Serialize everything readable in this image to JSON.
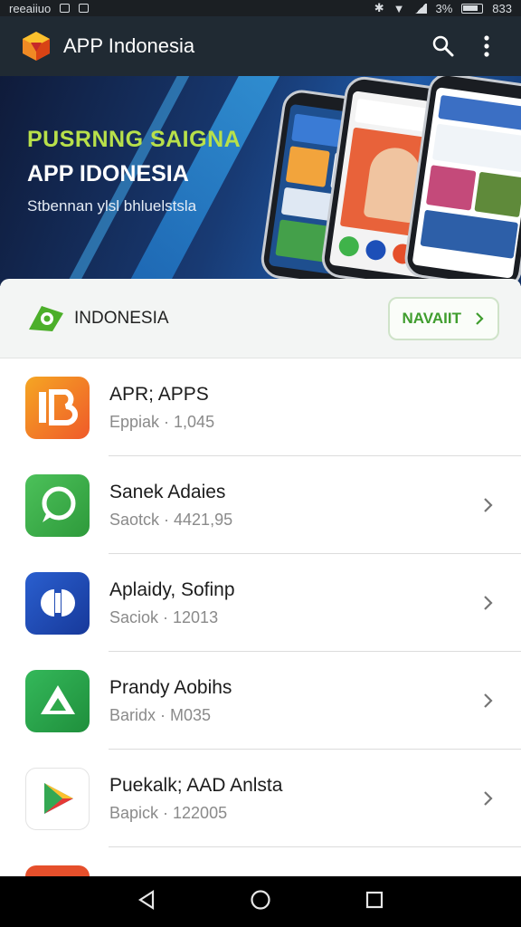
{
  "status_bar": {
    "left_text": "reeaiiuo",
    "right_text": "3%",
    "time": "833"
  },
  "app_bar": {
    "title": "APP Indonesia",
    "icons": [
      "app-logo-icon",
      "search-icon",
      "more-vert-icon"
    ]
  },
  "banner": {
    "headline": "PUSRNNG SAIGNA",
    "title": "APP IDONESIA",
    "subtitle": "Stbennan ylsl bhluelstsla"
  },
  "section": {
    "label": "INDONESIA",
    "nav_button": "NAVAIIT"
  },
  "apps": [
    {
      "name": "APR; APPS",
      "meta": "Eppiak · 1,045",
      "icon": "app-b-icon",
      "color": "#f37b2b"
    },
    {
      "name": "Sanek Adaies",
      "meta": "Saotck · 4421,95",
      "icon": "chat-bubble-icon",
      "color": "#3fb34a"
    },
    {
      "name": "Aplaidy, Sofinp",
      "meta": "Saciok · 12013",
      "icon": "split-circle-icon",
      "color": "#1d4fb8"
    },
    {
      "name": "Prandy Aobihs",
      "meta": "Baridx · M035",
      "icon": "triangle-a-icon",
      "color": "#2ea84a"
    },
    {
      "name": "Puekalk; AAD Anlsta",
      "meta": "Bapick · 122005",
      "icon": "play-arrow-icon",
      "color": "#ffffff"
    }
  ],
  "nav_bar": {
    "icons": [
      "back-icon",
      "home-icon",
      "recents-icon"
    ]
  }
}
